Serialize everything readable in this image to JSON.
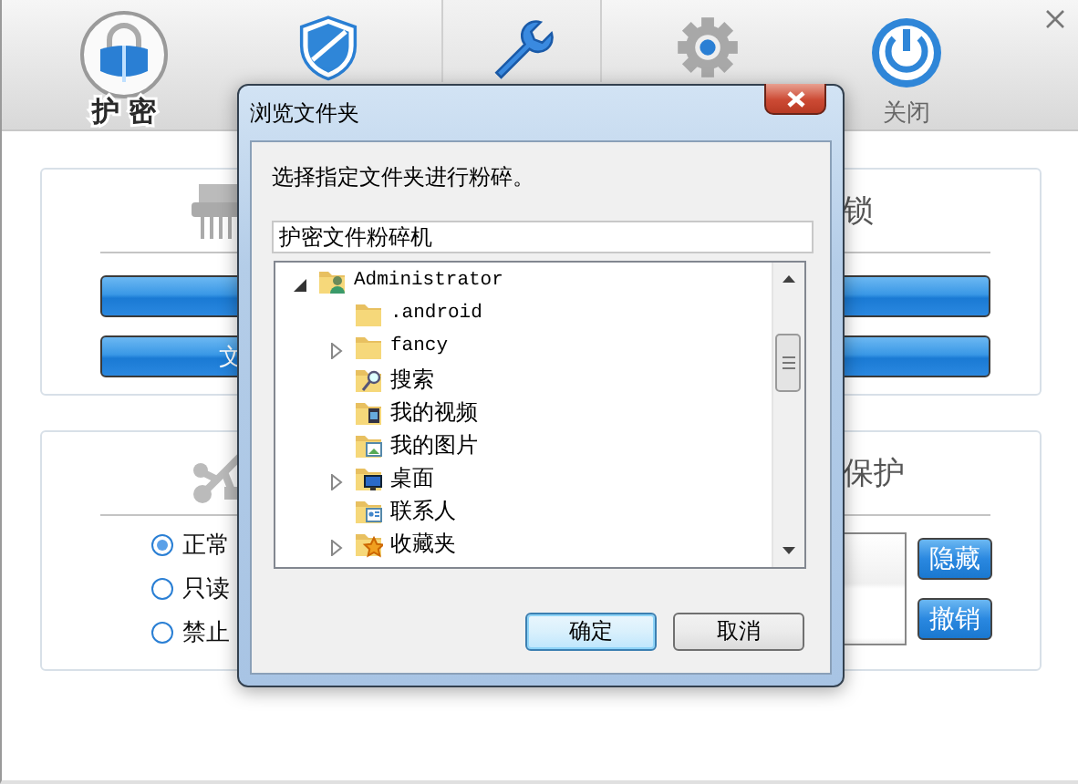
{
  "app": {
    "nav": [
      {
        "kind": "lock",
        "label": "护 密",
        "selected": false
      },
      {
        "kind": "shield",
        "selected": false
      },
      {
        "kind": "wrench",
        "selected": true
      },
      {
        "kind": "gear",
        "selected": false
      },
      {
        "kind": "power",
        "label": "关闭",
        "selected": false
      }
    ],
    "panels": [
      {
        "kind": "shredder",
        "title": "锁",
        "bars": [
          {
            "kind": "bar"
          },
          {
            "kind": "bar",
            "label": "文"
          }
        ]
      },
      {
        "kind": "usb",
        "title": "保护",
        "radios": [
          {
            "label": "正常",
            "selected": true
          },
          {
            "label": "只读",
            "selected": false
          },
          {
            "label": "禁止",
            "selected": false
          }
        ],
        "side_buttons": [
          "隐藏",
          "撤销"
        ]
      }
    ]
  },
  "dialog": {
    "title": "浏览文件夹",
    "prompt": "选择指定文件夹进行粉碎。",
    "folder_field": {
      "value": "护密文件粉碎机"
    },
    "tree": [
      {
        "label": "Administrator",
        "kind": "user",
        "expanded": true,
        "children": [
          {
            "label": ".android",
            "kind": "plain"
          },
          {
            "label": "fancy",
            "kind": "plain",
            "expanded": false
          },
          {
            "label": "搜索",
            "kind": "search"
          },
          {
            "label": "我的视频",
            "kind": "video"
          },
          {
            "label": "我的图片",
            "kind": "picture"
          },
          {
            "label": "桌面",
            "kind": "desktop",
            "expanded": false
          },
          {
            "label": "联系人",
            "kind": "contacts"
          },
          {
            "label": "收藏夹",
            "kind": "favorites",
            "expanded": false
          }
        ]
      }
    ],
    "buttons": [
      {
        "label": "确定",
        "default": true
      },
      {
        "label": "取消",
        "default": false
      }
    ]
  }
}
